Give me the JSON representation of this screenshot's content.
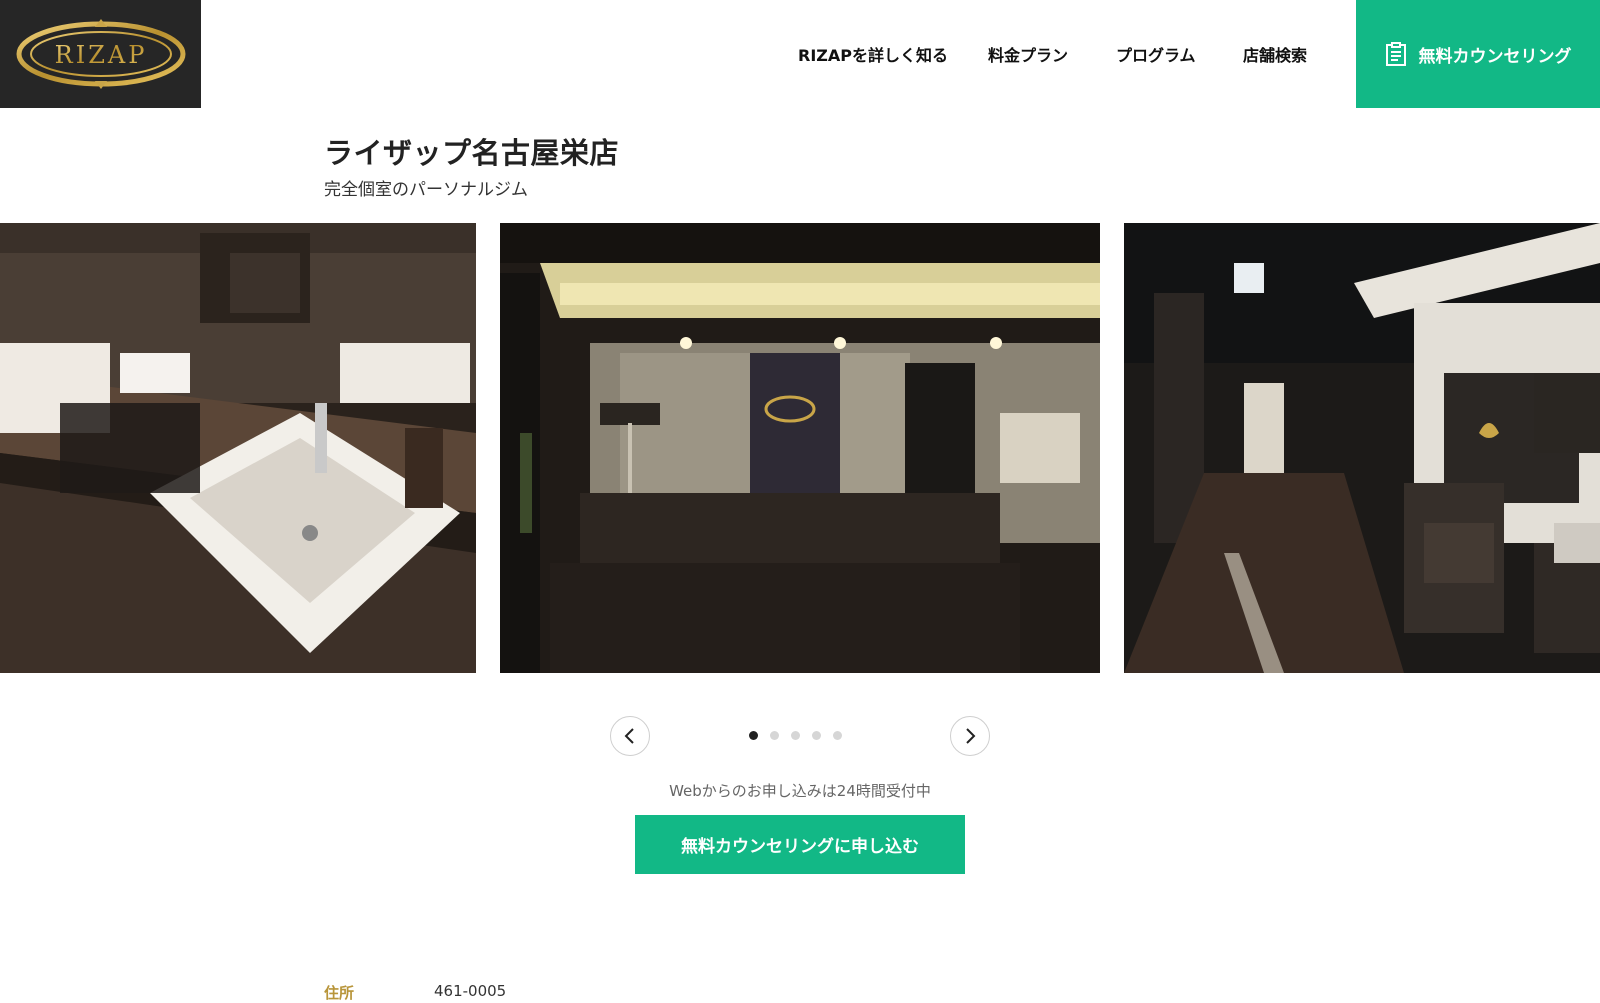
{
  "brand": {
    "logo_text": "RIZAP"
  },
  "nav": {
    "items": [
      "RIZAPを詳しく知る",
      "料金プラン",
      "プログラム",
      "店舗検索"
    ],
    "cta_label": "無料カウンセリング"
  },
  "store": {
    "name": "ライザップ名古屋栄店",
    "subtitle": "完全個室のパーソナルジム"
  },
  "carousel": {
    "slide_count": 5,
    "active_index": 0
  },
  "cta": {
    "note": "Webからのお申し込みは24時間受付中",
    "button_label": "無料カウンセリングに申し込む"
  },
  "info": {
    "address_label": "住所",
    "address_value": "461-0005"
  },
  "colors": {
    "accent": "#12b886",
    "logo_bg": "#262626",
    "gold": "#b8953a"
  }
}
